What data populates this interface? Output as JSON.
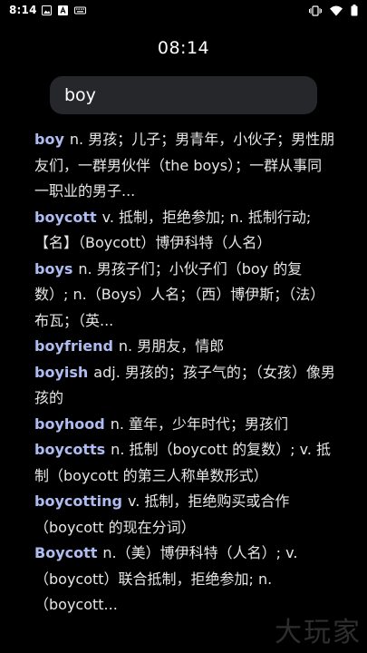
{
  "status_bar": {
    "time": "8:14",
    "icons": [
      "photo-icon",
      "text-icon",
      "keyboard-icon",
      "vibrate-icon",
      "wifi-icon",
      "battery-icon"
    ]
  },
  "clock": "08:14",
  "search": {
    "value": "boy",
    "placeholder": ""
  },
  "results": [
    {
      "word": "boy",
      "definition": "n. 男孩；儿子；男青年，小伙子；男性朋友们，一群男伙伴（the boys）；一群从事同一职业的男子..."
    },
    {
      "word": "boycott",
      "definition": "v. 抵制，拒绝参加; n. 抵制行动;【名】（Boycott）博伊科特（人名）"
    },
    {
      "word": "boys",
      "definition": "n. 男孩子们；小伙子们（boy 的复数）; n.（Boys）人名；（西）博伊斯；（法）布瓦；（英..."
    },
    {
      "word": "boyfriend",
      "definition": "n. 男朋友，情郎"
    },
    {
      "word": "boyish",
      "definition": "adj. 男孩的；孩子气的；（女孩）像男孩的"
    },
    {
      "word": "boyhood",
      "definition": "n. 童年，少年时代；男孩们"
    },
    {
      "word": "boycotts",
      "definition": "n. 抵制（boycott 的复数）; v. 抵制（boycott 的第三人称单数形式）"
    },
    {
      "word": "boycotting",
      "definition": "v. 抵制，拒绝购买或合作（boycott 的现在分词）"
    },
    {
      "word": "Boycott",
      "definition": "n.（美）博伊科特（人名）; v.（boycott）联合抵制，拒绝参加; n.（boycott..."
    }
  ],
  "watermark": "大玩家",
  "colors": {
    "background": "#000000",
    "word": "#aebcf2",
    "definition": "#e6e6e6",
    "search_bg": "#26272b"
  }
}
